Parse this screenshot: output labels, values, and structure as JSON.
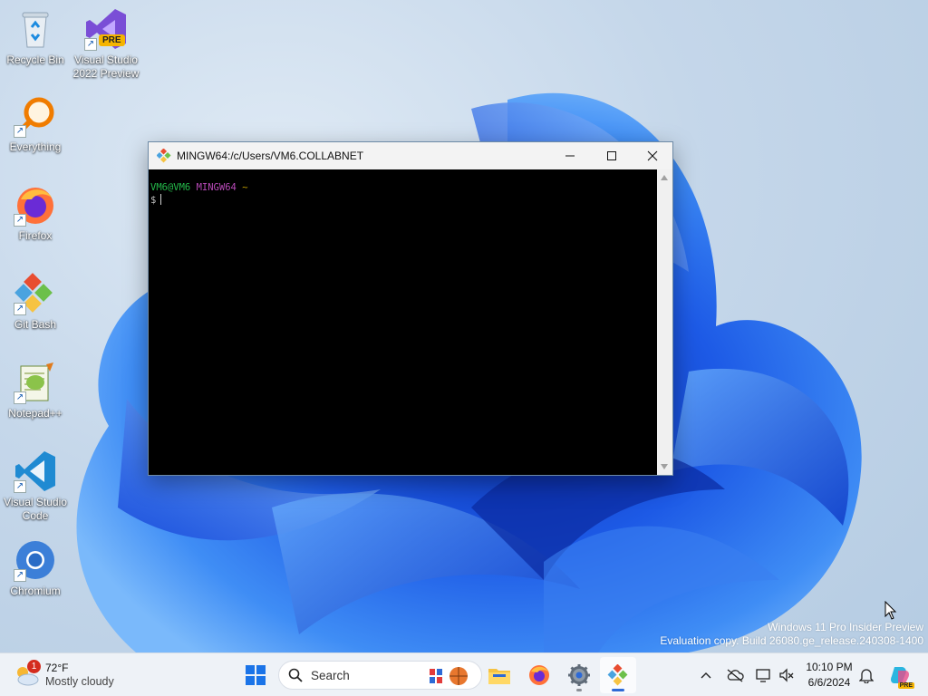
{
  "desktop": {
    "icons": [
      {
        "label": "Recycle Bin",
        "icon": "recycle-bin-icon"
      },
      {
        "label": "Visual Studio 2022 Preview",
        "icon": "visual-studio-icon",
        "badge": "PRE"
      },
      {
        "label": "Everything",
        "icon": "everything-search-icon"
      },
      {
        "label": "Firefox",
        "icon": "firefox-icon"
      },
      {
        "label": "Git Bash",
        "icon": "git-bash-icon"
      },
      {
        "label": "Notepad++",
        "icon": "notepad-plus-plus-icon"
      },
      {
        "label": "Visual Studio Code",
        "icon": "vscode-icon"
      },
      {
        "label": "Chromium",
        "icon": "chromium-icon"
      }
    ]
  },
  "window": {
    "title": "MINGW64:/c/Users/VM6.COLLABNET",
    "terminal": {
      "user_host": "VM6@VM6",
      "env": "MINGW64",
      "path": "~",
      "prompt": "$"
    }
  },
  "watermark": {
    "line1": "Windows 11 Pro Insider Preview",
    "line2": "Evaluation copy. Build 26080.ge_release.240308-1400"
  },
  "taskbar": {
    "weather": {
      "temp": "72°F",
      "condition": "Mostly cloudy",
      "badge": "1"
    },
    "search_placeholder": "Search",
    "clock": {
      "time": "10:10 PM",
      "date": "6/6/2024"
    },
    "copilot_badge": "PRE"
  },
  "colors": {
    "accent": "#0067c0",
    "terminal_bg": "#000000",
    "prompt_green": "#24b84a",
    "prompt_magenta": "#b84ab8"
  }
}
